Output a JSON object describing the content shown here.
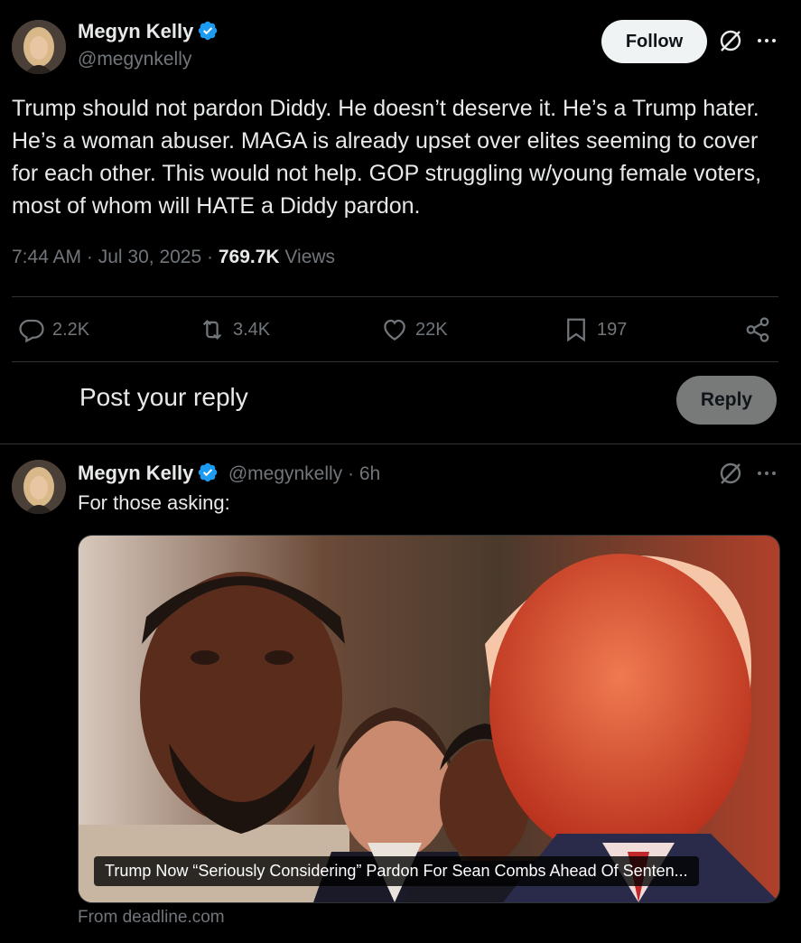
{
  "main_tweet": {
    "author_name": "Megyn Kelly",
    "author_handle": "@megynkelly",
    "follow_label": "Follow",
    "text": "Trump should not pardon Diddy. He doesn’t deserve it. He’s a Trump hater. He’s a woman abuser. MAGA is already upset over elites seeming to cover for each other. This would not help. GOP struggling w/young female voters, most of whom will HATE a Diddy pardon.",
    "time": "7:44 AM",
    "date": "Jul 30, 2025",
    "views_count": "769.7K",
    "views_label": "Views",
    "stats": {
      "replies": "2.2K",
      "reposts": "3.4K",
      "likes": "22K",
      "bookmarks": "197"
    }
  },
  "reply_box": {
    "placeholder": "Post your reply",
    "button_label": "Reply"
  },
  "reply_tweet": {
    "author_name": "Megyn Kelly",
    "author_handle": "@megynkelly",
    "time_ago": "6h",
    "text": "For those asking:",
    "card": {
      "caption": "Trump Now “Seriously Considering” Pardon For Sean Combs Ahead Of Senten...",
      "source": "From deadline.com"
    }
  },
  "colors": {
    "background": "#000000",
    "text": "#e7e9ea",
    "muted": "#71767b",
    "divider": "#2f3336",
    "verified": "#1d9bf0"
  }
}
